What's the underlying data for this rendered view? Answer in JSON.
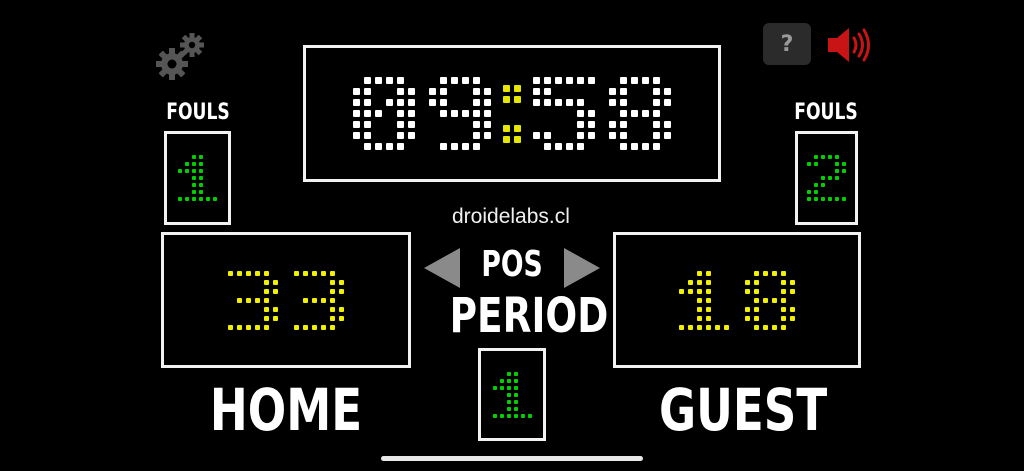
{
  "clock": {
    "minutes": "09",
    "seconds": "58",
    "color": "#ffffff",
    "colon_color": "#e6e600"
  },
  "home": {
    "label": "HOME",
    "score": "33",
    "fouls": "1",
    "fouls_label": "FOULS"
  },
  "guest": {
    "label": "GUEST",
    "score": "18",
    "fouls": "2",
    "fouls_label": "FOULS"
  },
  "possession": {
    "label": "POS"
  },
  "period": {
    "label": "PERIOD",
    "value": "1"
  },
  "brand": "droidelabs.cl",
  "controls": {
    "help_label": "?",
    "settings_icon": "gears-icon",
    "sound_icon": "speaker-on-icon"
  },
  "colors": {
    "score": "#f0f000",
    "fouls": "#00d000",
    "period": "#00d000",
    "frame": "#f2f2f2",
    "sound_icon": "#c81414",
    "settings_icon": "#555555"
  }
}
